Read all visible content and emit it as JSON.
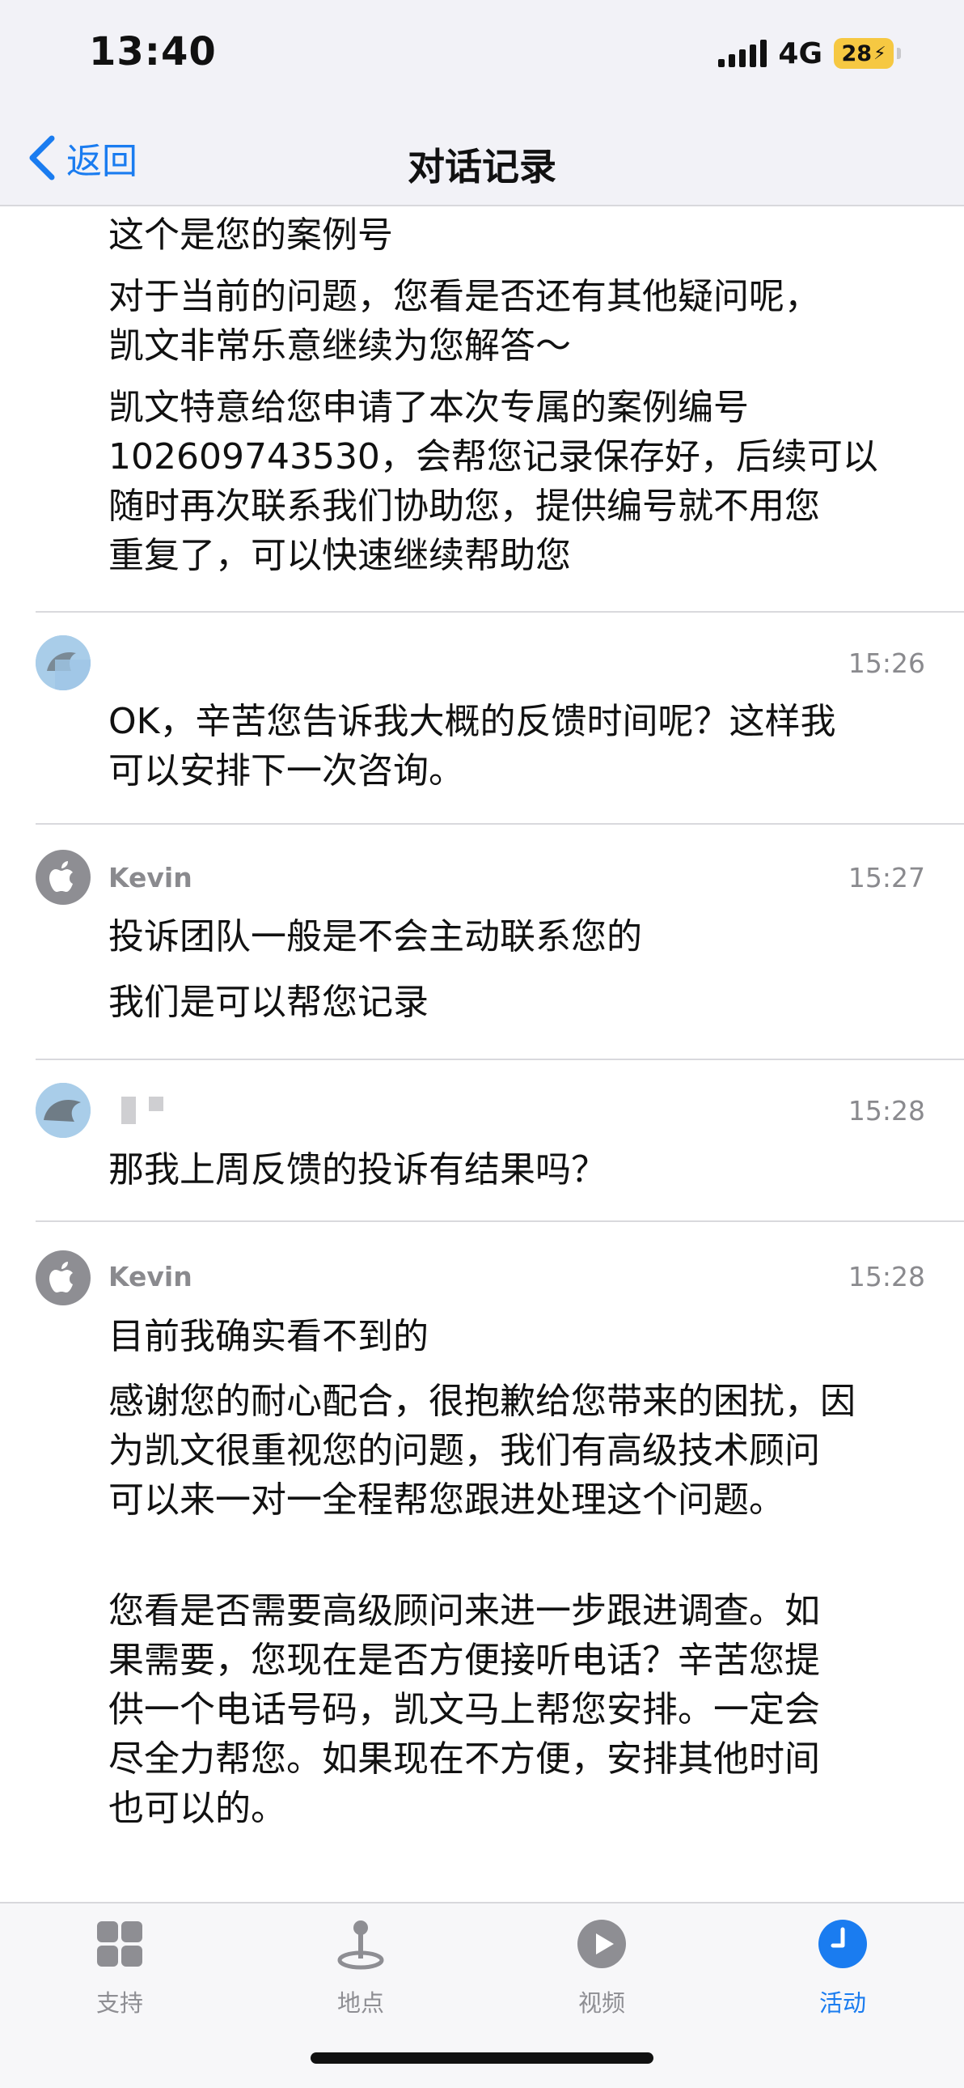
{
  "status_bar": {
    "time": "13:40",
    "network": "4G",
    "battery": "28"
  },
  "nav": {
    "back_label": "返回",
    "title": "对话记录"
  },
  "messages": {
    "m0": {
      "lines": [
        "这个是您的案例号",
        "对于当前的问题，您看是否还有其他疑问呢，\n凯文非常乐意继续为您解答～",
        "凯文特意给您申请了本次专属的案例编号\n102609743530，会帮您记录保存好，后续可以\n随时再次联系我们协助您，提供编号就不用您\n重复了，可以快速继续帮助您"
      ]
    },
    "m1": {
      "sender": "",
      "time": "15:26",
      "lines": [
        "OK，辛苦您告诉我大概的反馈时间呢？这样我\n可以安排下一次咨询。"
      ]
    },
    "m2": {
      "sender": "Kevin",
      "time": "15:27",
      "lines": [
        "投诉团队一般是不会主动联系您的",
        "我们是可以帮您记录"
      ]
    },
    "m3": {
      "sender": "",
      "time": "15:28",
      "lines": [
        "那我上周反馈的投诉有结果吗？"
      ]
    },
    "m4": {
      "sender": "Kevin",
      "time": "15:28",
      "lines": [
        "目前我确实看不到的",
        "感谢您的耐心配合，很抱歉给您带来的困扰，因\n为凯文很重视您的问题，我们有高级技术顾问\n可以来一对一全程帮您跟进处理这个问题。",
        "您看是否需要高级顾问来进一步跟进调查。如\n果需要，您现在是否方便接听电话？辛苦您提\n供一个电话号码，凯文马上帮您安排。一定会\n尽全力帮您。如果现在不方便，安排其他时间\n也可以的。"
      ]
    }
  },
  "tabs": {
    "support": "支持",
    "places": "地点",
    "video": "视频",
    "activity": "活动"
  },
  "colors": {
    "accent": "#1a7cf0",
    "battery": "#f6c842",
    "agent_avatar": "#8e8e93",
    "user_avatar": "#a9cde9"
  }
}
